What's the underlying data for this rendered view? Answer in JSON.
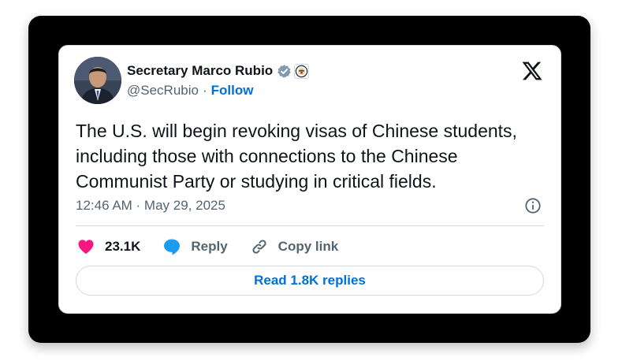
{
  "tweet": {
    "display_name": "Secretary Marco Rubio",
    "handle": "@SecRubio",
    "separator": "·",
    "follow_label": "Follow",
    "text": "The U.S. will begin revoking visas of Chinese students, including those with connections to the Chinese Communist Party or studying in critical fields.",
    "timestamp": "12:46 AM · May 29, 2025"
  },
  "actions": {
    "likes_count": "23.1K",
    "reply_label": "Reply",
    "copy_link_label": "Copy link"
  },
  "read_replies_label": "Read 1.8K replies",
  "colors": {
    "frame_background": "#000000",
    "card_background": "#ffffff",
    "text_primary": "#0f1419",
    "text_secondary": "#536471",
    "link_blue": "#006fd6",
    "heart_pink": "#f91880",
    "reply_blue": "#1d9bf0",
    "verified_gray": "#829aab",
    "border": "#cfd9de"
  },
  "icons": {
    "verified": "verified-badge-icon",
    "affiliation": "us-state-department-seal-icon",
    "logo": "x-logo-icon",
    "info": "info-icon",
    "like": "heart-icon",
    "reply": "speech-bubble-icon",
    "copy_link": "link-icon"
  }
}
